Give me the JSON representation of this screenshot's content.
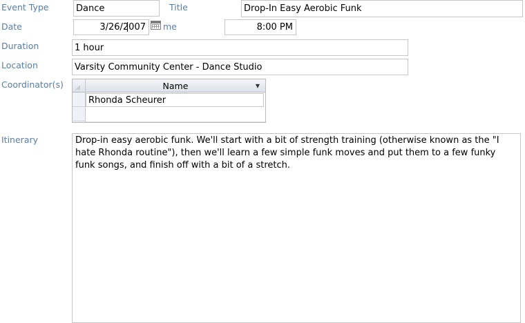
{
  "form": {
    "event_type": {
      "label": "Event Type",
      "value": "Dance"
    },
    "title": {
      "label": "Title",
      "value": "Drop-In Easy Aerobic Funk"
    },
    "date": {
      "label": "Date",
      "value": "3/26/2007"
    },
    "time": {
      "label": "me",
      "value": "8:00 PM"
    },
    "duration": {
      "label": "Duration",
      "value": "1 hour"
    },
    "location": {
      "label": "Location",
      "value": "Varsity Community Center - Dance Studio"
    },
    "coordinators": {
      "label": "Coordinator(s)",
      "column_header": "Name",
      "rows": [
        "Rhonda Scheurer"
      ]
    },
    "itinerary": {
      "label": "Itinerary",
      "value": "Drop-in easy aerobic funk.  We'll start with a bit of strength training (otherwise known as the \"I hate Rhonda routine\"), then we'll learn a few simple funk moves and put them to a few funky funk songs, and finish off with a bit of a stretch."
    }
  },
  "icons": {
    "calendar": "calendar-icon",
    "sort": "dropdown-arrow-icon"
  },
  "colors": {
    "label": "#5b7da5",
    "border": "#c6c6c6"
  }
}
